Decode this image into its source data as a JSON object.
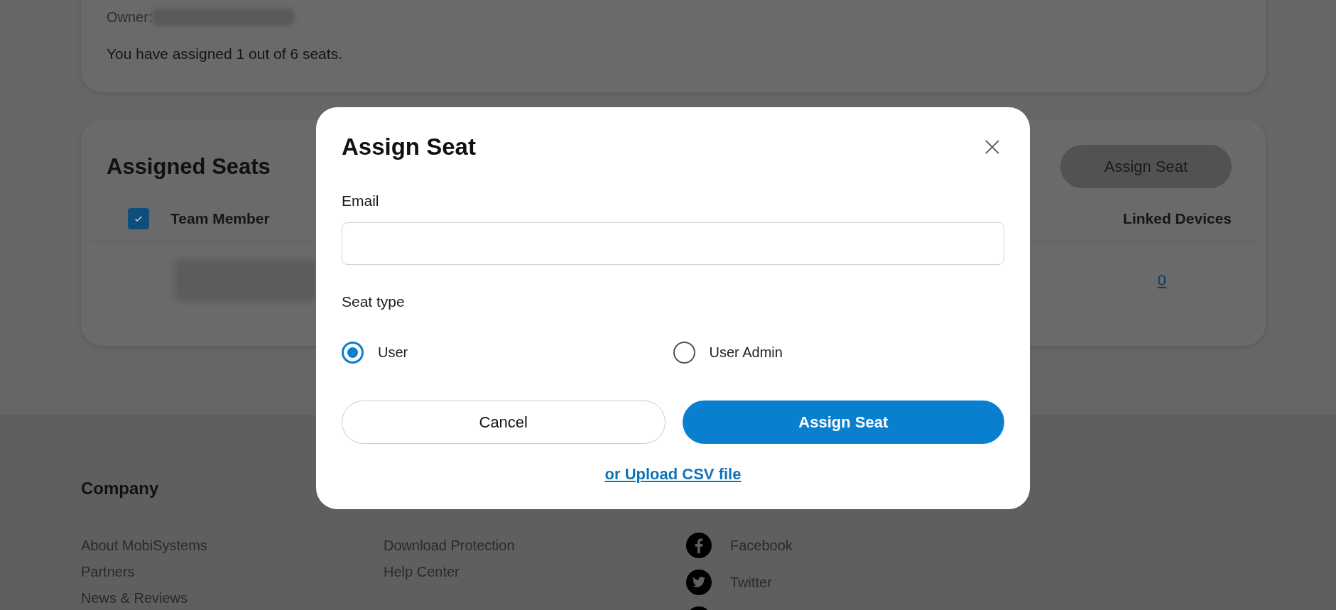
{
  "account": {
    "owner_label": "Owner:",
    "seats_summary": "You have assigned 1 out of 6 seats."
  },
  "assigned_seats": {
    "title": "Assigned Seats",
    "assign_button": "Assign Seat",
    "select_all_checked": true,
    "columns": [
      {
        "label": "Team Member"
      },
      {
        "label": "Linked Devices"
      }
    ],
    "rows": [
      {
        "linked_devices": "0"
      }
    ]
  },
  "footer": {
    "columns": [
      {
        "title": "Company",
        "links": [
          {
            "label": "About MobiSystems"
          },
          {
            "label": "Partners"
          },
          {
            "label": "News & Reviews"
          }
        ]
      },
      {
        "links": [
          {
            "label": "Download Protection"
          },
          {
            "label": "Help Center"
          }
        ]
      },
      {
        "social": [
          {
            "kind": "facebook",
            "label": "Facebook"
          },
          {
            "kind": "twitter",
            "label": "Twitter"
          },
          {
            "kind": "other"
          }
        ]
      }
    ]
  },
  "dialog": {
    "title": "Assign Seat",
    "email_label": "Email",
    "seat_type_label": "Seat type",
    "seat_types": [
      {
        "label": "User",
        "selected": true
      },
      {
        "label": "User Admin",
        "selected": false
      }
    ],
    "cancel_button": "Cancel",
    "confirm_button": "Assign Seat",
    "upload_link": "or Upload CSV file"
  }
}
